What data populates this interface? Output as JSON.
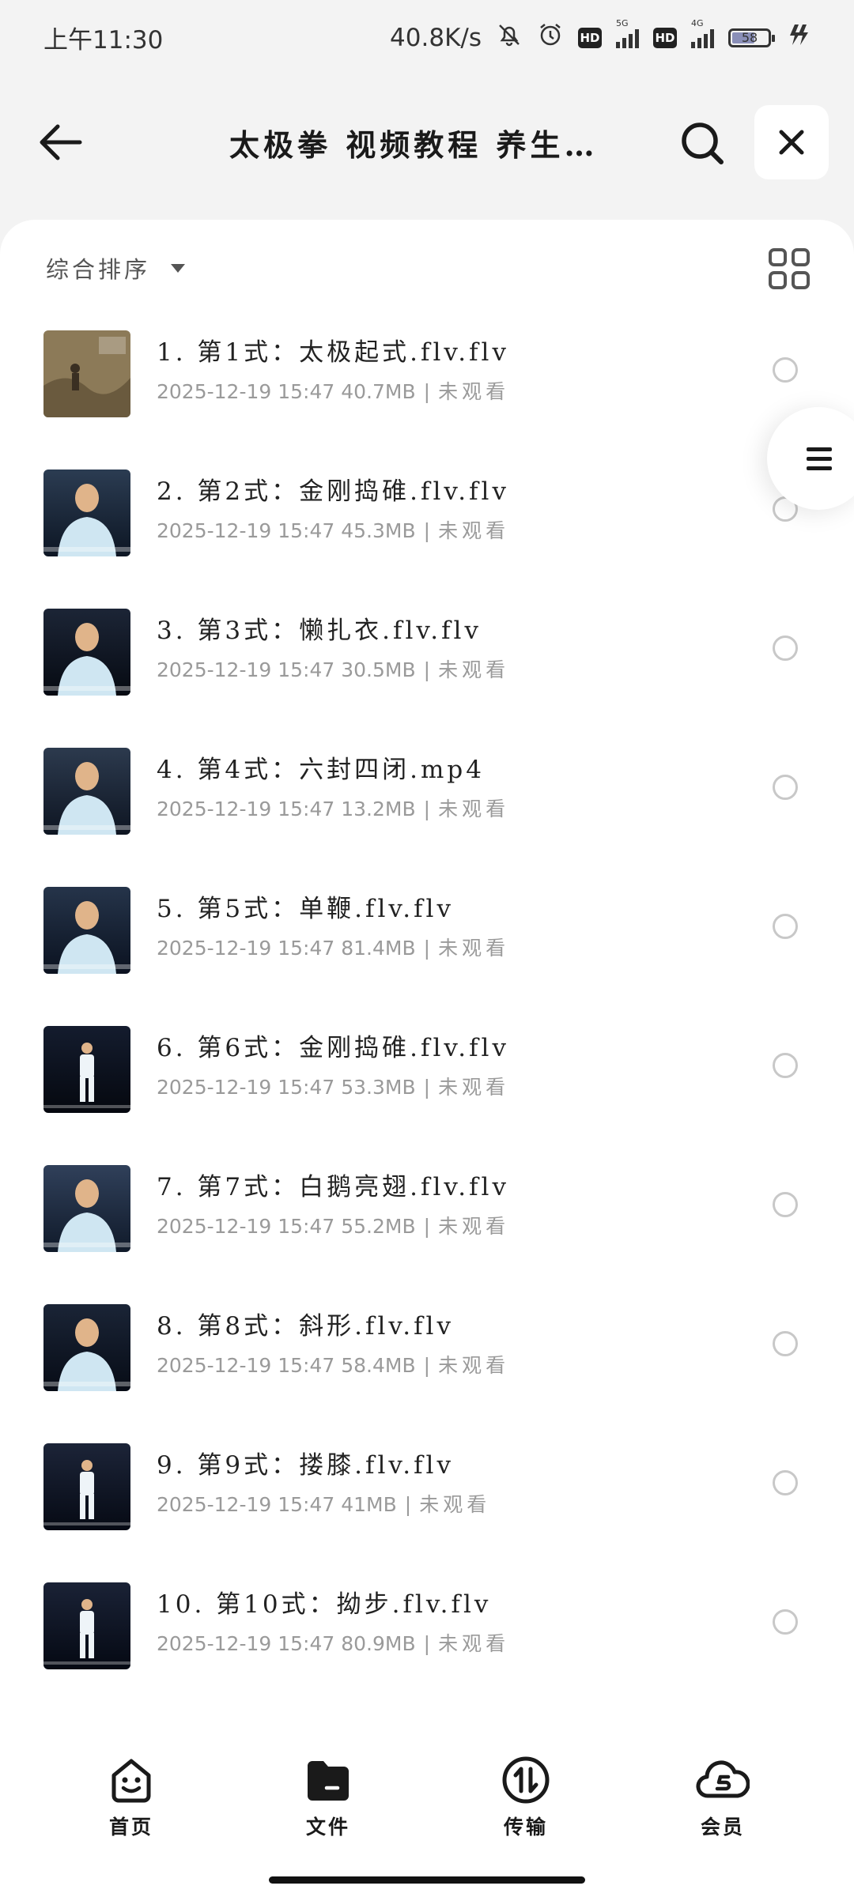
{
  "status_bar": {
    "time": "上午11:30",
    "network_speed": "40.8K/s",
    "hd1": "HD",
    "sig1_label": "5G",
    "hd2": "HD",
    "sig2_label": "4G",
    "battery": "58"
  },
  "header": {
    "title": "太极拳 视频教程 养生…"
  },
  "toolbar": {
    "sort_label": "综合排序"
  },
  "files": [
    {
      "name": "1. 第1式：太极起式.flv.flv",
      "date": "2025-12-19 15:47",
      "size": "40.7MB",
      "status": "未观看"
    },
    {
      "name": "2. 第2式：金刚捣碓.flv.flv",
      "date": "2025-12-19 15:47",
      "size": "45.3MB",
      "status": "未观看"
    },
    {
      "name": "3. 第3式：懒扎衣.flv.flv",
      "date": "2025-12-19 15:47",
      "size": "30.5MB",
      "status": "未观看"
    },
    {
      "name": "4. 第4式：六封四闭.mp4",
      "date": "2025-12-19 15:47",
      "size": "13.2MB",
      "status": "未观看"
    },
    {
      "name": "5. 第5式：单鞭.flv.flv",
      "date": "2025-12-19 15:47",
      "size": "81.4MB",
      "status": "未观看"
    },
    {
      "name": "6. 第6式：金刚捣碓.flv.flv",
      "date": "2025-12-19 15:47",
      "size": "53.3MB",
      "status": "未观看"
    },
    {
      "name": "7. 第7式：白鹅亮翅.flv.flv",
      "date": "2025-12-19 15:47",
      "size": "55.2MB",
      "status": "未观看"
    },
    {
      "name": "8. 第8式：斜形.flv.flv",
      "date": "2025-12-19 15:47",
      "size": "58.4MB",
      "status": "未观看"
    },
    {
      "name": "9. 第9式：搂膝.flv.flv",
      "date": "2025-12-19 15:47",
      "size": "41MB",
      "status": "未观看"
    },
    {
      "name": "10. 第10式：拗步.flv.flv",
      "date": "2025-12-19 15:47",
      "size": "80.9MB",
      "status": "未观看"
    }
  ],
  "bottom_nav": {
    "home": "首页",
    "files": "文件",
    "transfer": "传输",
    "vip": "会员"
  },
  "colors": {
    "background": "#f3f3f3",
    "card": "#ffffff",
    "meta_text": "#9a9a9a"
  }
}
